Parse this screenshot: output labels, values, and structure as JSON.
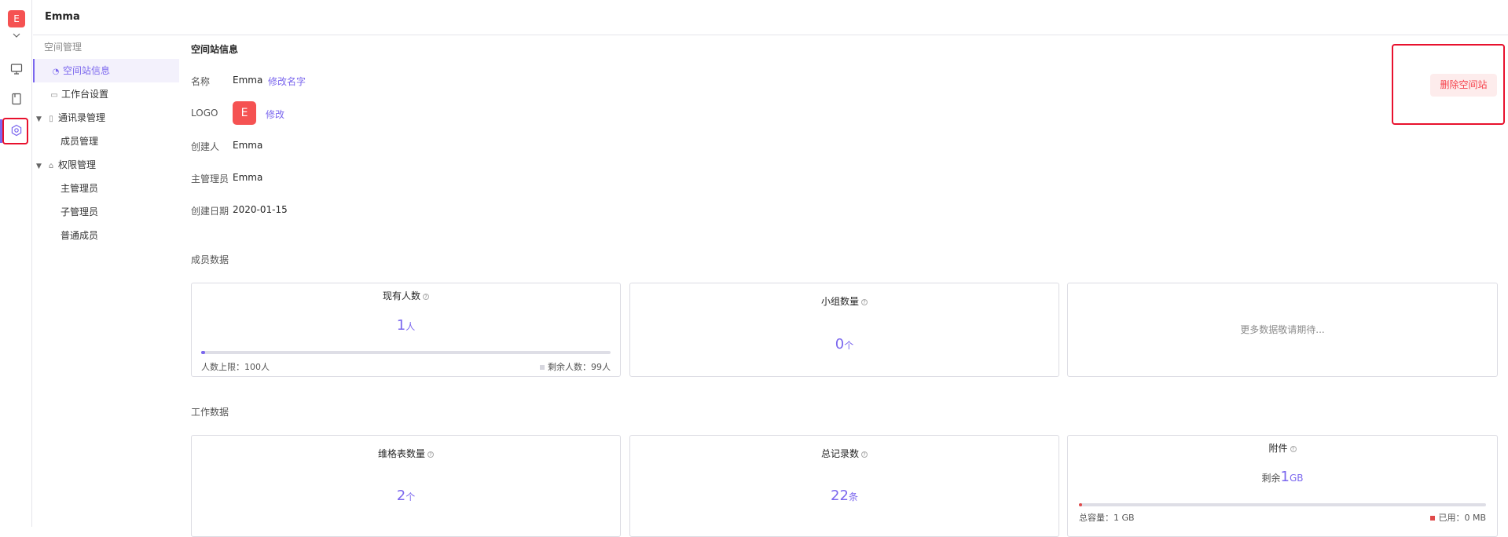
{
  "rail": {
    "avatar_letter": "E",
    "icons": [
      "monitor-icon",
      "book-icon",
      "settings-icon"
    ]
  },
  "header": {
    "space_name": "Emma"
  },
  "sidebar": {
    "group_title": "空间管理",
    "items": [
      {
        "label": "空间站信息",
        "icon": "space-icon",
        "active": true
      },
      {
        "label": "工作台设置",
        "icon": "workbench-icon"
      },
      {
        "label": "通讯录管理",
        "icon": "contacts-icon",
        "expanded": true
      },
      {
        "label": "成员管理"
      },
      {
        "label": "权限管理",
        "icon": "permission-icon",
        "expanded": true
      },
      {
        "label": "主管理员"
      },
      {
        "label": "子管理员"
      },
      {
        "label": "普通成员"
      }
    ]
  },
  "info": {
    "title": "空间站信息",
    "name_label": "名称",
    "name_value": "Emma",
    "rename_link": "修改名字",
    "logo_label": "LOGO",
    "logo_letter": "E",
    "logo_edit_link": "修改",
    "creator_label": "创建人",
    "creator_value": "Emma",
    "admin_label": "主管理员",
    "admin_value": "Emma",
    "created_label": "创建日期",
    "created_value": "2020-01-15",
    "delete_button": "删除空间站"
  },
  "member_section": {
    "title": "成员数据",
    "members": {
      "title": "现有人数",
      "value": "1",
      "unit": "人",
      "progress": 0.01,
      "limit_text": "人数上限：100人",
      "remaining_text": "剩余人数：99人",
      "accent": "#7b67ee"
    },
    "groups": {
      "title": "小组数量",
      "value": "0",
      "unit": "个"
    },
    "more": {
      "text": "更多数据敬请期待..."
    }
  },
  "work_section": {
    "title": "工作数据",
    "sheets": {
      "title": "维格表数量",
      "value": "2",
      "unit": "个"
    },
    "records": {
      "title": "总记录数",
      "value": "22",
      "unit": "条"
    },
    "attachments": {
      "title": "附件",
      "prefix": "剩余",
      "value": "1",
      "unit": "GB",
      "progress": 0.0,
      "total_text": "总容量：1 GB",
      "used_text": "已用：0 MB",
      "accent": "#e04a4a"
    }
  }
}
